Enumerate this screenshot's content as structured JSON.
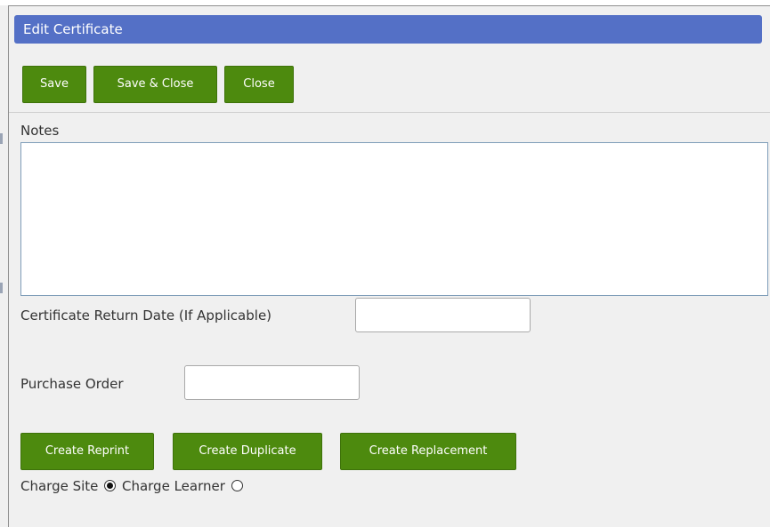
{
  "dialog": {
    "title": "Edit Certificate"
  },
  "toolbar": {
    "save_label": "Save",
    "save_close_label": "Save & Close",
    "close_label": "Close"
  },
  "form": {
    "notes_label": "Notes",
    "notes_value": "",
    "return_date_label": "Certificate Return Date (If Applicable)",
    "return_date_value": "",
    "purchase_order_label": "Purchase Order",
    "purchase_order_value": ""
  },
  "actions": {
    "reprint_label": "Create Reprint",
    "duplicate_label": "Create Duplicate",
    "replacement_label": "Create Replacement"
  },
  "charge": {
    "site_label": "Charge Site",
    "learner_label": "Charge Learner",
    "selected": "site"
  },
  "colors": {
    "title_bar": "#5470c6",
    "button": "#4d8a0e",
    "background": "#f0f0f0"
  }
}
